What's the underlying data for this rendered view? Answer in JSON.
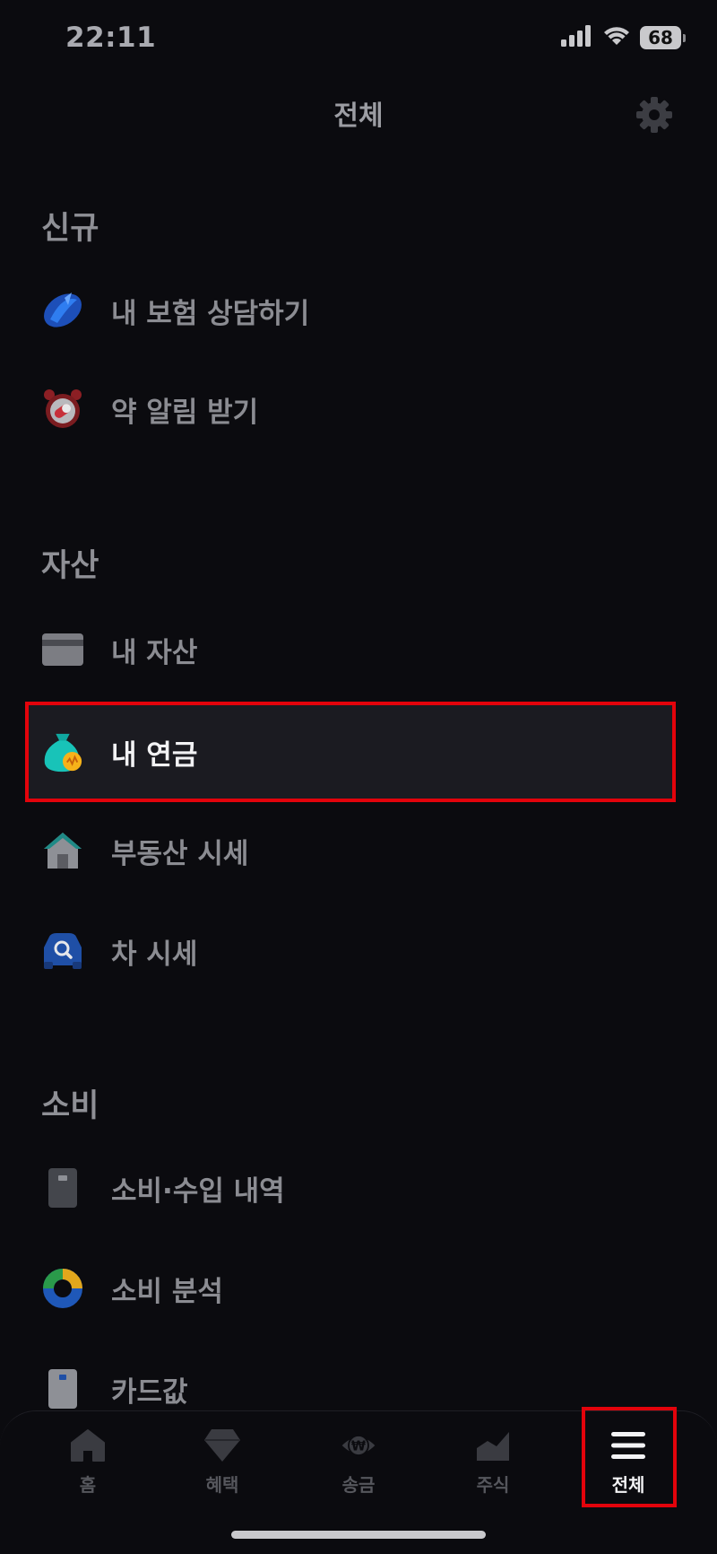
{
  "status_bar": {
    "time": "22:11",
    "battery": "68",
    "icons": [
      "cellular-signal-icon",
      "wifi-icon",
      "battery-icon"
    ]
  },
  "header": {
    "title": "전체",
    "settings_icon": "gear-icon"
  },
  "sections": {
    "new": {
      "title": "신규",
      "items": [
        {
          "label": "내 보험 상담하기",
          "icon": "insurance-shield-icon"
        },
        {
          "label": "약 알림 받기",
          "icon": "pill-alarm-clock-icon"
        }
      ]
    },
    "assets": {
      "title": "자산",
      "items": [
        {
          "label": "내 자산",
          "icon": "card-icon"
        },
        {
          "label": "내 연금",
          "icon": "pension-money-bag-icon",
          "highlighted": true
        },
        {
          "label": "부동산 시세",
          "icon": "house-icon"
        },
        {
          "label": "차 시세",
          "icon": "car-search-icon"
        }
      ]
    },
    "spending": {
      "title": "소비",
      "items": [
        {
          "label": "소비·수입 내역",
          "icon": "phone-receipt-icon"
        },
        {
          "label": "소비 분석",
          "icon": "donut-chart-icon"
        },
        {
          "label": "카드값",
          "icon": "card-vertical-icon"
        }
      ]
    }
  },
  "bottom_nav": {
    "items": [
      {
        "label": "홈",
        "icon": "home-icon"
      },
      {
        "label": "혜택",
        "icon": "diamond-gift-icon"
      },
      {
        "label": "송금",
        "icon": "won-transfer-icon"
      },
      {
        "label": "주식",
        "icon": "stock-chart-icon"
      },
      {
        "label": "전체",
        "icon": "menu-hamburger-icon",
        "active": true
      }
    ]
  },
  "colors": {
    "background": "#0b0b0f",
    "highlight_border": "#e3030b",
    "highlight_fill": "#1b1b21"
  }
}
